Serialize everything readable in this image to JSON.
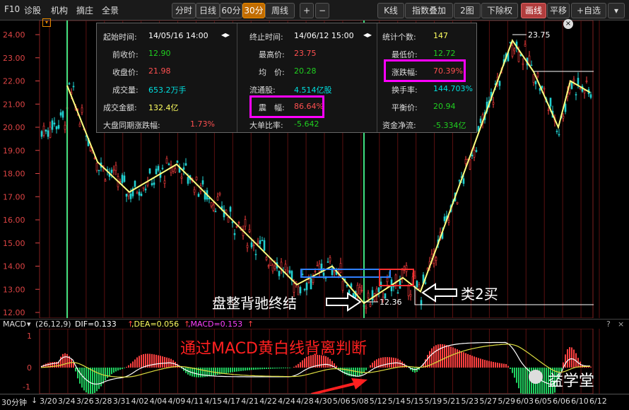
{
  "toolbar": {
    "left": [
      "F10",
      "诊股",
      "机构",
      "摘庄",
      "全景"
    ],
    "periods": [
      "分时",
      "日线",
      "60分",
      "30分",
      "周线"
    ],
    "active_period": "30分",
    "plus": "+",
    "minus": "−",
    "right": [
      "K线",
      "指数叠加",
      "2图",
      "下除权",
      "画线",
      "平移",
      "+自选"
    ]
  },
  "y_axis": [
    "24.00",
    "23.00",
    "22.00",
    "21.00",
    "20.00",
    "19.00",
    "18.00",
    "17.00",
    "16.00",
    "15.00",
    "14.00",
    "13.00",
    "12.00"
  ],
  "stats": {
    "start_label": "起始时间:",
    "start_value": "14/05/16 14:00",
    "end_label": "终止时间:",
    "end_value": "14/06/12 15:00",
    "count_label": "统计个数:",
    "count_value": "147",
    "prev_close_label": "前收价:",
    "prev_close_value": "12.90",
    "high_label": "最高价:",
    "high_value": "23.75",
    "low_label": "最低价:",
    "low_value": "12.72",
    "close_label": "收盘价:",
    "close_value": "21.98",
    "avg_label": "均　价:",
    "avg_value": "20.28",
    "chg_label": "涨跌幅:",
    "chg_value": "70.39%",
    "vol_label": "成交量:",
    "vol_value": "653.2万手",
    "float_label": "流通股:",
    "float_value": "4.514亿股",
    "turnover_label": "换手率:",
    "turnover_value": "144.703%",
    "amount_label": "成交金额:",
    "amount_value": "132.4亿",
    "amp_label": "震　幅:",
    "amp_value": "86.64%",
    "balance_label": "平衡价:",
    "balance_value": "20.94",
    "market_label": "大盘同期涨跌幅:",
    "market_value": "1.73%",
    "bigorder_label": "大单比率:",
    "bigorder_value": "-5.642",
    "netflow_label": "资金净流:",
    "netflow_value": "-5.334亿",
    "close_icon": "×"
  },
  "annotations": {
    "high_mark": "23.75",
    "low_mark": "12.36",
    "consolidation": "盘整背驰终结",
    "buy2": "类2买",
    "macd_note": "通过MACD黄白线背离判断",
    "watermark": "益学堂"
  },
  "macd": {
    "name": "MACD",
    "params": "(26,12,9)",
    "dif": "DIF=0.133",
    "dea": ",DEA=0.056",
    "macd": ",MACD=0.153",
    "help": "?",
    "close": "×",
    "ticks": [
      "1",
      "0",
      "-1"
    ]
  },
  "x_axis": {
    "period": "30分钟",
    "dates": [
      "3/20",
      "3/24",
      "3/26",
      "3/28",
      "3/31",
      "4/02",
      "4/04",
      "4/09",
      "4/11",
      "4/15",
      "4/17",
      "4/21",
      "4/22",
      "4/24",
      "4/28",
      "4/30",
      "5/06",
      "5/08",
      "5/12",
      "5/14",
      "5/15",
      "5/19",
      "5/21",
      "5/23",
      "5/27",
      "5/29",
      "6/03",
      "6/05",
      "6/06",
      "6/10",
      "6/12"
    ]
  },
  "colors": {
    "up": "#ff4040",
    "down": "#20d0d0",
    "zigzag": "#ffff80",
    "green_line": "#40e080",
    "highlight": "#ff00ff"
  }
}
